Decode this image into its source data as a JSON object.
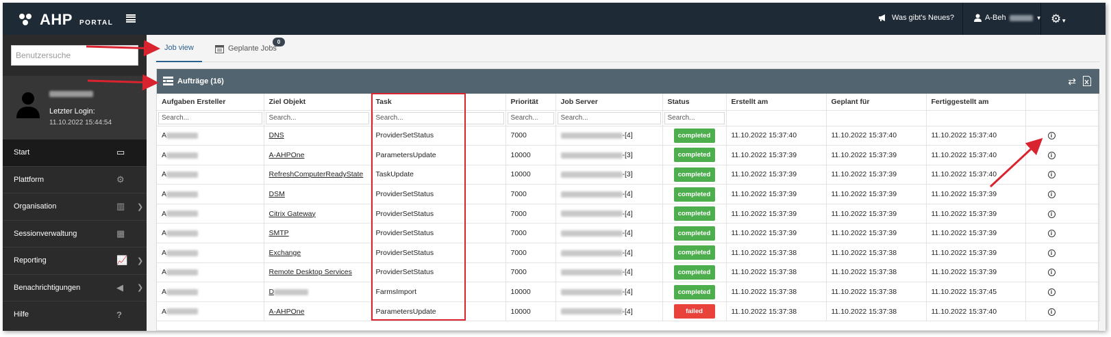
{
  "app": {
    "name": "AHP",
    "subtitle": "PORTAL"
  },
  "header": {
    "news_label": "Was gibt's Neues?",
    "user_label": "A-Beh",
    "colors": {
      "bar": "#1f2a37"
    }
  },
  "sidebar": {
    "search_placeholder": "Benutzersuche",
    "profile": {
      "last_login_label": "Letzter Login:",
      "last_login_date": "11.10.2022 15:44:54"
    },
    "items": [
      {
        "label": "Start",
        "icon": "monitor-icon",
        "active": true
      },
      {
        "label": "Plattform",
        "icon": "gears-icon"
      },
      {
        "label": "Organisation",
        "icon": "building-icon",
        "chevron": true
      },
      {
        "label": "Sessionverwaltung",
        "icon": "sessions-icon"
      },
      {
        "label": "Reporting",
        "icon": "chart-icon",
        "chevron": true
      },
      {
        "label": "Benachrichtigungen",
        "icon": "megaphone-icon",
        "chevron": true
      },
      {
        "label": "Hilfe",
        "icon": "question-icon"
      }
    ]
  },
  "tabs": [
    {
      "label": "Job view",
      "active": true
    },
    {
      "label": "Geplante Jobs",
      "badge": "0"
    }
  ],
  "panel": {
    "title": "Aufträge (16)"
  },
  "table": {
    "columns": [
      "Aufgaben Ersteller",
      "Ziel Objekt",
      "Task",
      "Priorität",
      "Job Server",
      "Status",
      "Erstellt am",
      "Geplant für",
      "Fertiggestellt am",
      ""
    ],
    "search_placeholder": "Search...",
    "rows": [
      {
        "creator": "A",
        "target": "DNS",
        "task": "ProviderSetStatus",
        "priority": "7000",
        "server_suffix": "-[4]",
        "status": "completed",
        "created": "11.10.2022 15:37:40",
        "planned": "11.10.2022 15:37:40",
        "finished": "11.10.2022 15:37:40"
      },
      {
        "creator": "A",
        "target": "A-AHPOne",
        "task": "ParametersUpdate",
        "priority": "10000",
        "server_suffix": "-[3]",
        "status": "completed",
        "created": "11.10.2022 15:37:39",
        "planned": "11.10.2022 15:37:39",
        "finished": "11.10.2022 15:37:40"
      },
      {
        "creator": "A",
        "target": "RefreshComputerReadyState",
        "task": "TaskUpdate",
        "priority": "10000",
        "server_suffix": "-[3]",
        "status": "completed",
        "created": "11.10.2022 15:37:39",
        "planned": "11.10.2022 15:37:39",
        "finished": "11.10.2022 15:37:40"
      },
      {
        "creator": "A",
        "target": "DSM",
        "task": "ProviderSetStatus",
        "priority": "7000",
        "server_suffix": "-[4]",
        "status": "completed",
        "created": "11.10.2022 15:37:39",
        "planned": "11.10.2022 15:37:39",
        "finished": "11.10.2022 15:37:39"
      },
      {
        "creator": "A",
        "target": "Citrix Gateway",
        "task": "ProviderSetStatus",
        "priority": "7000",
        "server_suffix": "-[4]",
        "status": "completed",
        "created": "11.10.2022 15:37:39",
        "planned": "11.10.2022 15:37:39",
        "finished": "11.10.2022 15:37:39"
      },
      {
        "creator": "A",
        "target": "SMTP",
        "task": "ProviderSetStatus",
        "priority": "7000",
        "server_suffix": "-[4]",
        "status": "completed",
        "created": "11.10.2022 15:37:39",
        "planned": "11.10.2022 15:37:39",
        "finished": "11.10.2022 15:37:39"
      },
      {
        "creator": "A",
        "target": "Exchange",
        "task": "ProviderSetStatus",
        "priority": "7000",
        "server_suffix": "-[4]",
        "status": "completed",
        "created": "11.10.2022 15:37:38",
        "planned": "11.10.2022 15:37:38",
        "finished": "11.10.2022 15:37:39"
      },
      {
        "creator": "A",
        "target": "Remote Desktop Services",
        "task": "ProviderSetStatus",
        "priority": "7000",
        "server_suffix": "-[4]",
        "status": "completed",
        "created": "11.10.2022 15:37:38",
        "planned": "11.10.2022 15:37:38",
        "finished": "11.10.2022 15:37:39"
      },
      {
        "creator": "A",
        "target": "D",
        "task": "FarmsImport",
        "priority": "10000",
        "server_suffix": "-[4]",
        "status": "completed",
        "created": "11.10.2022 15:37:38",
        "planned": "11.10.2022 15:37:38",
        "finished": "11.10.2022 15:37:45"
      },
      {
        "creator": "A",
        "target": "A-AHPOne",
        "task": "ParametersUpdate",
        "priority": "10000",
        "server_suffix": "-[4]",
        "status": "failed",
        "created": "11.10.2022 15:37:38",
        "planned": "11.10.2022 15:37:38",
        "finished": "11.10.2022 15:37:40"
      }
    ]
  },
  "colors": {
    "completed": "#4cae4c",
    "failed": "#e8423a",
    "annotation": "#d9232e"
  }
}
